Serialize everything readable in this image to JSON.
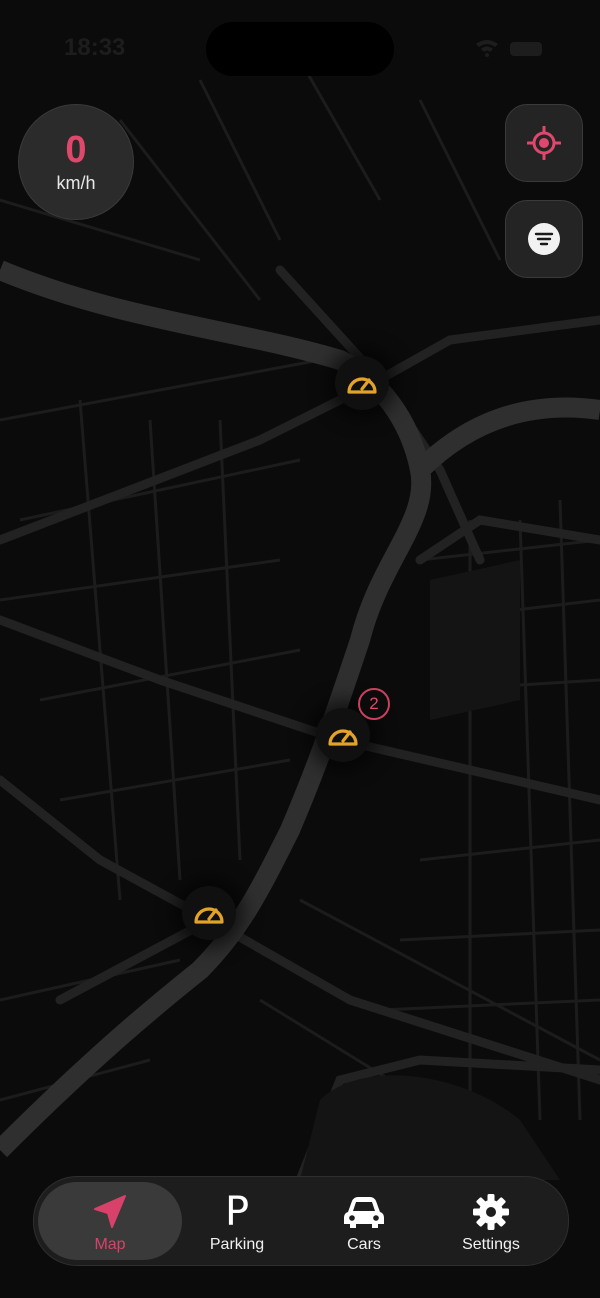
{
  "status_bar": {
    "time": "18:33"
  },
  "speed": {
    "value": "0",
    "unit": "km/h"
  },
  "cluster": {
    "count": "2"
  },
  "tabs": [
    {
      "label": "Map",
      "icon": "navigation-arrow-icon",
      "active": true
    },
    {
      "label": "Parking",
      "icon": "parking-icon",
      "glyph": "P"
    },
    {
      "label": "Cars",
      "icon": "car-icon"
    },
    {
      "label": "Settings",
      "icon": "gear-icon"
    }
  ],
  "colors": {
    "accent": "#e0476c",
    "camera": "#e3a32b",
    "map_background": "#0b0b0b",
    "road": "#262626",
    "river": "#2f2f2f"
  }
}
